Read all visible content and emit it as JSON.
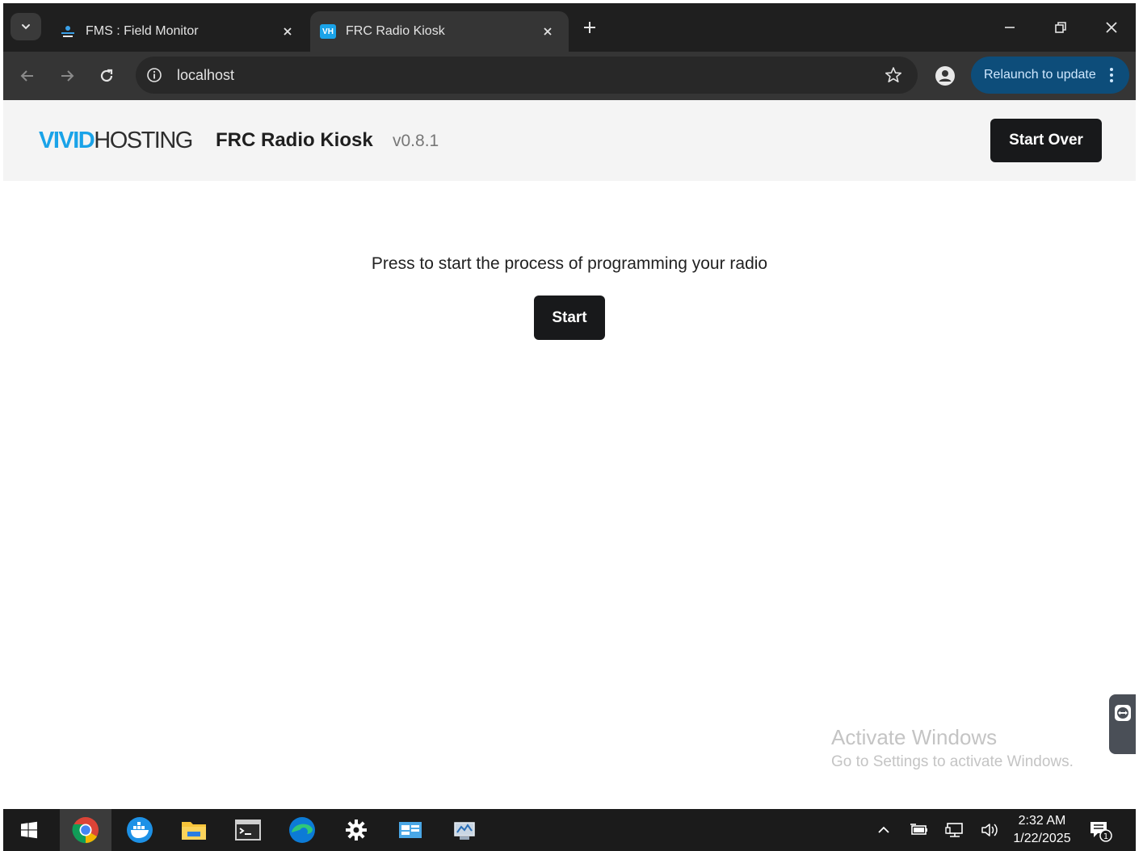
{
  "browser": {
    "tabs": [
      {
        "title": "FMS : Field Monitor",
        "active": false
      },
      {
        "title": "FRC Radio Kiosk",
        "active": true,
        "favicon_text": "VH"
      }
    ],
    "address": "localhost",
    "relaunch_label": "Relaunch to update"
  },
  "header": {
    "logo_part1": "VIVID",
    "logo_part2": "HOSTING",
    "app_title": "FRC Radio Kiosk",
    "version": "v0.8.1",
    "start_over_label": "Start Over"
  },
  "main": {
    "prompt": "Press to start the process of programming your radio",
    "start_label": "Start"
  },
  "watermark": {
    "title": "Activate Windows",
    "subtitle": "Go to Settings to activate Windows."
  },
  "taskbar": {
    "time": "2:32 AM",
    "date": "1/22/2025",
    "notification_count": "1"
  },
  "colors": {
    "brand_blue": "#1aa3e8",
    "button_dark": "#18191b",
    "relaunch_bg": "#0d4d7a"
  }
}
